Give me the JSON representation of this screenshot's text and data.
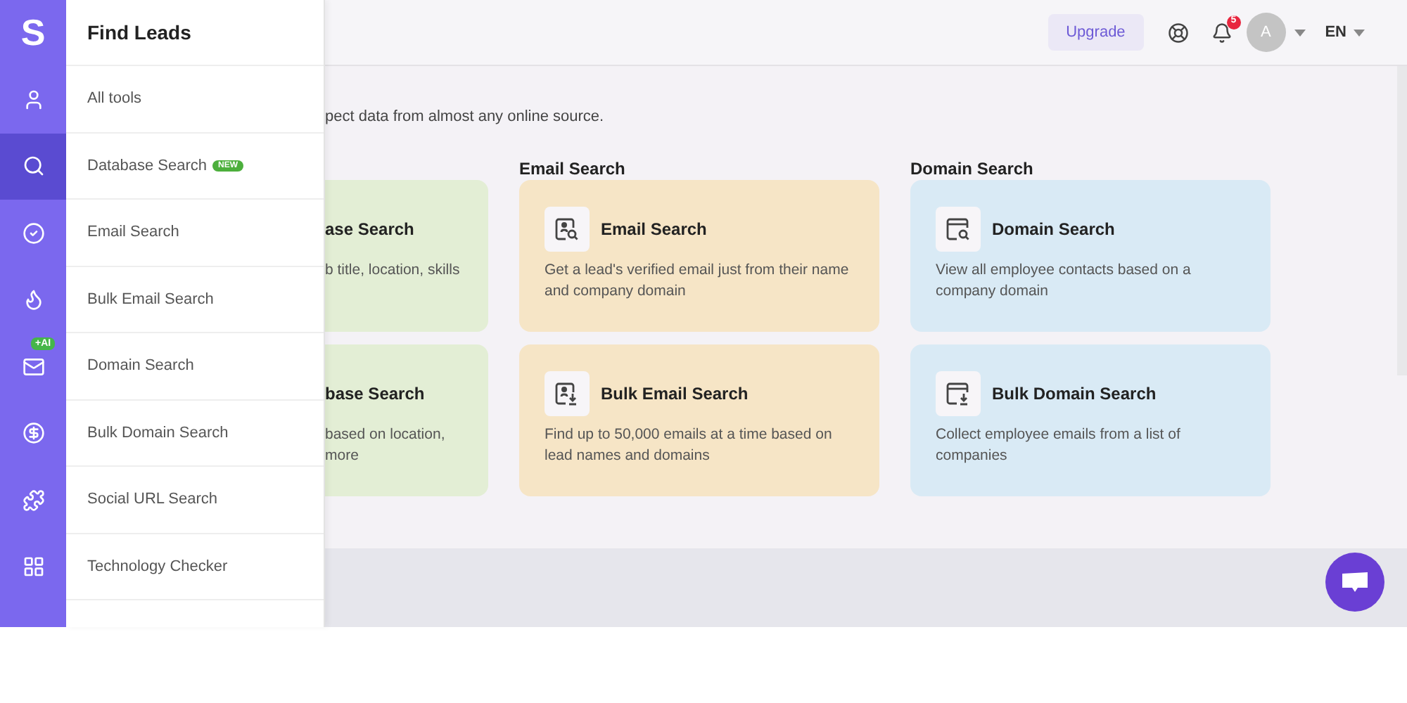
{
  "rail": {
    "logo": "S",
    "items": [
      {
        "kind": "user",
        "selected": false
      },
      {
        "kind": "search",
        "selected": true
      },
      {
        "kind": "check",
        "selected": false
      },
      {
        "kind": "flame",
        "selected": false
      },
      {
        "kind": "mail",
        "selected": false,
        "badge": "+AI"
      },
      {
        "kind": "dollar",
        "selected": false
      },
      {
        "kind": "puzzle",
        "selected": false
      },
      {
        "kind": "grid",
        "selected": false
      }
    ]
  },
  "flyout": {
    "title": "Find Leads",
    "items": [
      {
        "label": "All tools"
      },
      {
        "label": "Database Search",
        "badge": "NEW"
      },
      {
        "label": "Email Search"
      },
      {
        "label": "Bulk Email Search"
      },
      {
        "label": "Domain Search"
      },
      {
        "label": "Bulk Domain Search"
      },
      {
        "label": "Social URL Search"
      },
      {
        "label": "Technology Checker"
      }
    ]
  },
  "header": {
    "upgrade": "Upgrade",
    "notifications": "5",
    "avatar": "A",
    "language": "EN"
  },
  "subtitle": "pect data from almost any online source.",
  "columns": [
    {
      "kind": "cut",
      "color": "#e3eed5",
      "cards": [
        {
          "title": "ase Search",
          "lines": [
            "b title, location, skills"
          ]
        },
        {
          "title": "base Search",
          "lines": [
            "based on location,",
            "more"
          ]
        }
      ]
    },
    {
      "kind": "full",
      "heading": "Email Search",
      "color": "#f6e5c6",
      "cards": [
        {
          "kind": "person-search",
          "title": "Email Search",
          "lines": [
            "Get a lead's verified email just from their name",
            "and company domain"
          ]
        },
        {
          "kind": "person-download",
          "title": "Bulk Email Search",
          "lines": [
            "Find up to 50,000 emails at a time based on",
            "lead names and domains"
          ]
        }
      ]
    },
    {
      "kind": "full",
      "heading": "Domain Search",
      "color": "#d9eaf5",
      "cards": [
        {
          "kind": "browser-search",
          "title": "Domain Search",
          "lines": [
            "View all employee contacts based on a",
            "company domain"
          ]
        },
        {
          "kind": "browser-download",
          "title": "Bulk Domain Search",
          "lines": [
            "Collect employee emails from a list of",
            "companies"
          ]
        }
      ]
    }
  ]
}
